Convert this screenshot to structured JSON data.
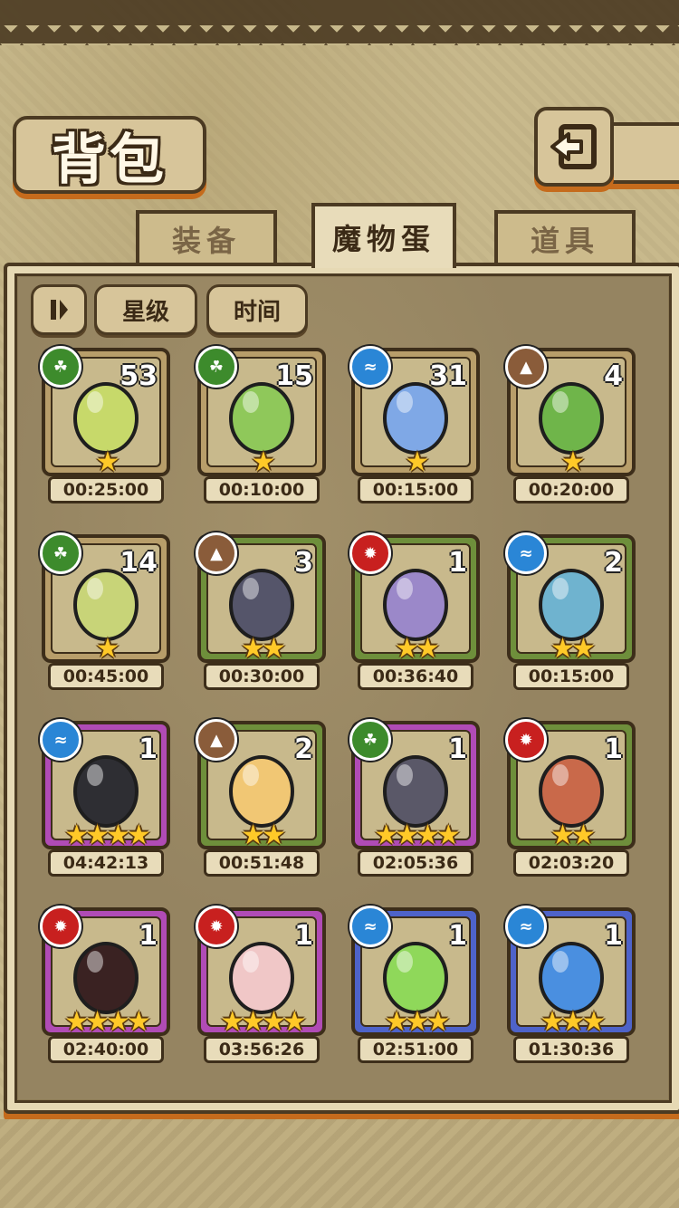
{
  "header": {
    "title": "背包",
    "back_icon": "back-arrow-icon"
  },
  "tabs": [
    {
      "label": "装备",
      "active": false
    },
    {
      "label": "魔物蛋",
      "active": true
    },
    {
      "label": "道具",
      "active": false
    }
  ],
  "controls": {
    "pause_icon": "pause-icon",
    "sort_star_label": "星级",
    "sort_time_label": "时间"
  },
  "colors": {
    "grass": "#3d8b2c",
    "water": "#2a86d6",
    "earth": "#8a5c3a",
    "fire": "#c8201f",
    "star": "#ffc928",
    "accent": "#c56b1c"
  },
  "eggs": [
    {
      "element": "grass",
      "count": "53",
      "stars": 1,
      "time": "00:25:00",
      "egg_color": "#c7d96a"
    },
    {
      "element": "grass",
      "count": "15",
      "stars": 1,
      "time": "00:10:00",
      "egg_color": "#8fc85a"
    },
    {
      "element": "water",
      "count": "31",
      "stars": 1,
      "time": "00:15:00",
      "egg_color": "#7fa8e6"
    },
    {
      "element": "earth",
      "count": "4",
      "stars": 1,
      "time": "00:20:00",
      "egg_color": "#6fb54a"
    },
    {
      "element": "grass",
      "count": "14",
      "stars": 1,
      "time": "00:45:00",
      "egg_color": "#c8d478"
    },
    {
      "element": "earth",
      "count": "3",
      "stars": 2,
      "time": "00:30:00",
      "egg_color": "#55556a"
    },
    {
      "element": "fire",
      "count": "1",
      "stars": 2,
      "time": "00:36:40",
      "egg_color": "#9b88c9"
    },
    {
      "element": "water",
      "count": "2",
      "stars": 2,
      "time": "00:15:00",
      "egg_color": "#6fb3cf"
    },
    {
      "element": "water",
      "count": "1",
      "stars": 4,
      "time": "04:42:13",
      "egg_color": "#2e2e33"
    },
    {
      "element": "earth",
      "count": "2",
      "stars": 2,
      "time": "00:51:48",
      "egg_color": "#f1c774"
    },
    {
      "element": "grass",
      "count": "1",
      "stars": 4,
      "time": "02:05:36",
      "egg_color": "#5a5868"
    },
    {
      "element": "fire",
      "count": "1",
      "stars": 2,
      "time": "02:03:20",
      "egg_color": "#c9694a"
    },
    {
      "element": "fire",
      "count": "1",
      "stars": 4,
      "time": "02:40:00",
      "egg_color": "#3a2222"
    },
    {
      "element": "fire",
      "count": "1",
      "stars": 4,
      "time": "03:56:26",
      "egg_color": "#f0c7c7"
    },
    {
      "element": "water",
      "count": "1",
      "stars": 3,
      "time": "02:51:00",
      "egg_color": "#8fd85a"
    },
    {
      "element": "water",
      "count": "1",
      "stars": 3,
      "time": "01:30:36",
      "egg_color": "#4a8fe0"
    }
  ]
}
